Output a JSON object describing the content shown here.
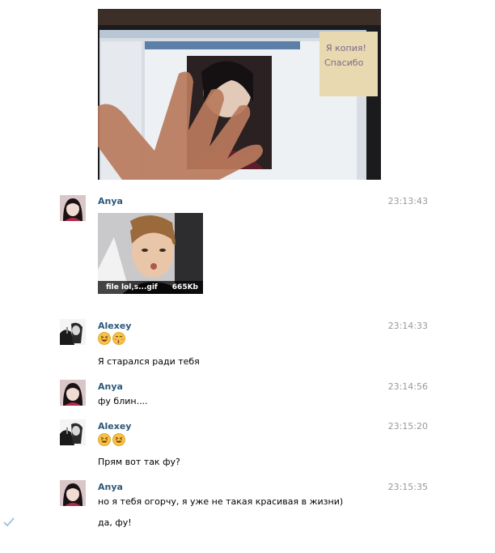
{
  "messages": [
    {
      "author": "Anya",
      "time": "23:13:43",
      "attachment": {
        "name": "file lol,s...gif",
        "size": "665Kb"
      }
    },
    {
      "author": "Alexey",
      "time": "23:14:33",
      "emoji": [
        "laughing-emoji",
        "kissing-emoji"
      ],
      "text": "Я старался ради тебя"
    },
    {
      "author": "Anya",
      "time": "23:14:56",
      "text": "фу блин...."
    },
    {
      "author": "Alexey",
      "time": "23:15:20",
      "emoji": [
        "laughing-emoji",
        "laughing-emoji"
      ],
      "text": "Прям вот так фу?"
    },
    {
      "author": "Anya",
      "time": "23:15:35",
      "text": "но я тебя огорчу, я уже не такая красивая в жизни)",
      "text2": "да, фу!"
    }
  ],
  "photo": {
    "sticky_note_line1": "Я копия!",
    "sticky_note_line2": "Спасибо"
  },
  "colors": {
    "author": "#2b587a",
    "time": "#999999",
    "check": "#a8c4dc"
  }
}
